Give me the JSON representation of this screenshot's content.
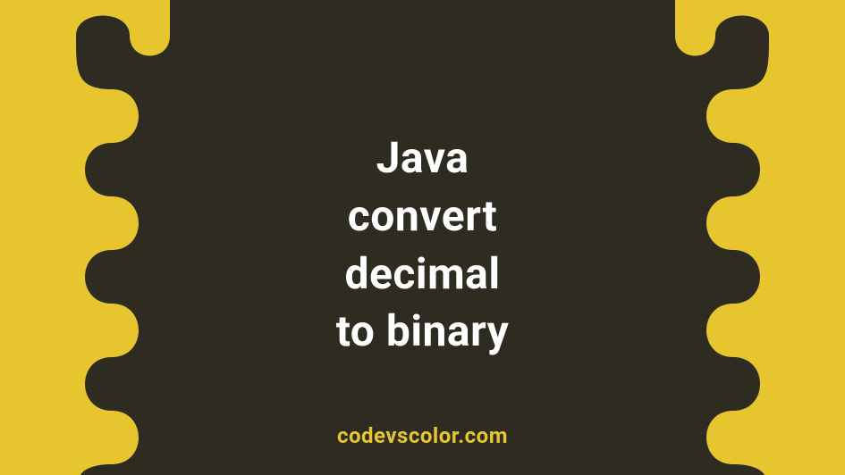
{
  "graphic": {
    "title_line1": "Java",
    "title_line2": "convert",
    "title_line3": "decimal",
    "title_line4": "to binary",
    "credit": "codevscolor.com",
    "colors": {
      "background": "#e7c52f",
      "blob": "#2e2b21",
      "title_text": "#ffffff",
      "credit_text": "#e7c52f"
    }
  }
}
